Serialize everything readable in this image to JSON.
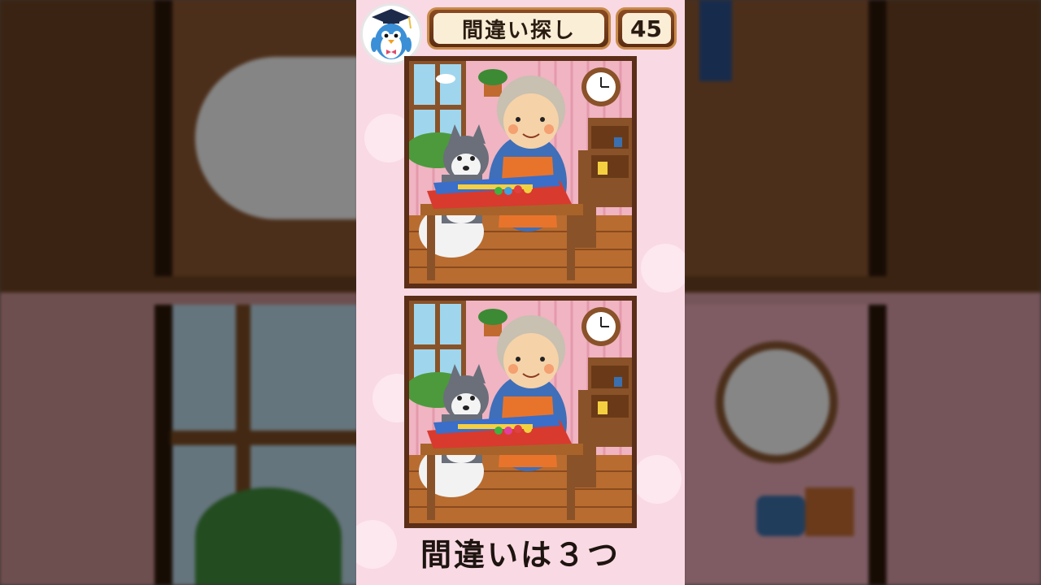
{
  "header": {
    "title": "間違い探し",
    "puzzle_number": "45"
  },
  "footer": {
    "hint": "間違いは３つ"
  },
  "icons": {
    "mascot": "penguin-graduate-icon"
  },
  "colors": {
    "background_pink": "#f9d9e3",
    "frame_brown": "#5a2e18",
    "plate_wood": "#8a4a22",
    "plate_cream": "#fbeed6"
  }
}
